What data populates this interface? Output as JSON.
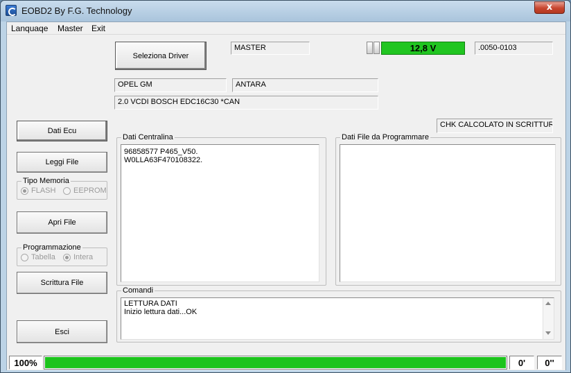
{
  "window": {
    "title": "EOBD2 By F.G. Technology",
    "close_label": "x"
  },
  "menu": [
    "Lanquaqe",
    "Master",
    "Exit"
  ],
  "top": {
    "driver_button": "Seleziona Driver",
    "mode_field": "MASTER",
    "voltage": "12,8 V",
    "version": ".0050-0103",
    "make": "OPEL GM",
    "model": "ANTARA",
    "engine": "2.0  VCDI   BOSCH EDC16C30  *CAN",
    "chk_status": "CHK CALCOLATO IN SCRITTURA"
  },
  "left": {
    "dati_ecu": "Dati Ecu",
    "leggi_file": "Leggi File",
    "tipo_memoria": {
      "label": "Tipo Memoria",
      "options": [
        "FLASH",
        "EEPROM"
      ],
      "selected": "FLASH"
    },
    "apri_file": "Apri File",
    "programmazione": {
      "label": "Programmazione",
      "options": [
        "Tabella",
        "Intera"
      ],
      "selected": "Intera"
    },
    "scrittura_file": "Scrittura File",
    "esci": "Esci"
  },
  "dati_centralina": {
    "label": "Dati Centralina",
    "lines": [
      "96858577  P465_V50.",
      "W0LLA63F470108322."
    ]
  },
  "dati_file": {
    "label": "Dati File da Programmare",
    "lines": []
  },
  "comandi": {
    "label": "Comandi",
    "lines": [
      "LETTURA DATI",
      "Inizio lettura dati...OK"
    ]
  },
  "status": {
    "percent": "100%",
    "progress_fraction": 1.0,
    "minutes": "0'",
    "seconds": "0''"
  },
  "colors": {
    "progress_green": "#1cc41c",
    "voltage_green": "#21c521"
  }
}
